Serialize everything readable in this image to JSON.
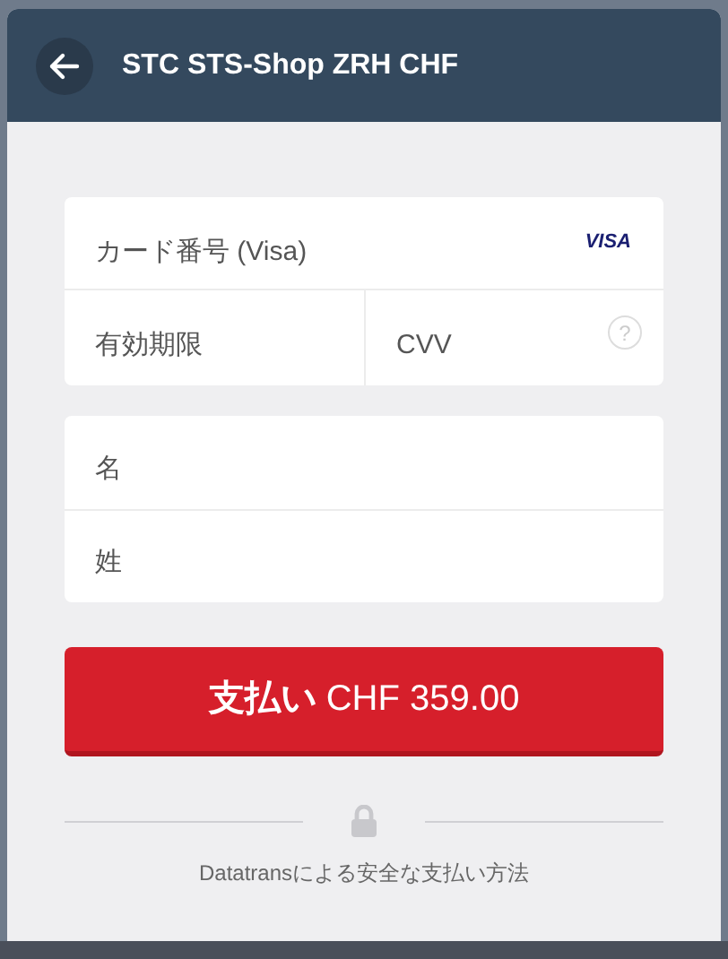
{
  "header": {
    "title": "STC STS-Shop ZRH CHF"
  },
  "card_fields": {
    "number": {
      "placeholder": "カード番号 (Visa)",
      "brand": "VISA"
    },
    "expiry": {
      "placeholder": "有効期限"
    },
    "cvv": {
      "placeholder": "CVV",
      "help": "?"
    }
  },
  "name_fields": [
    {
      "placeholder": "名"
    },
    {
      "placeholder": "姓"
    }
  ],
  "pay_button": {
    "label": "**支払い** CHF 359.00"
  },
  "footer": {
    "text": "Datatransによる安全な支払い方法"
  }
}
